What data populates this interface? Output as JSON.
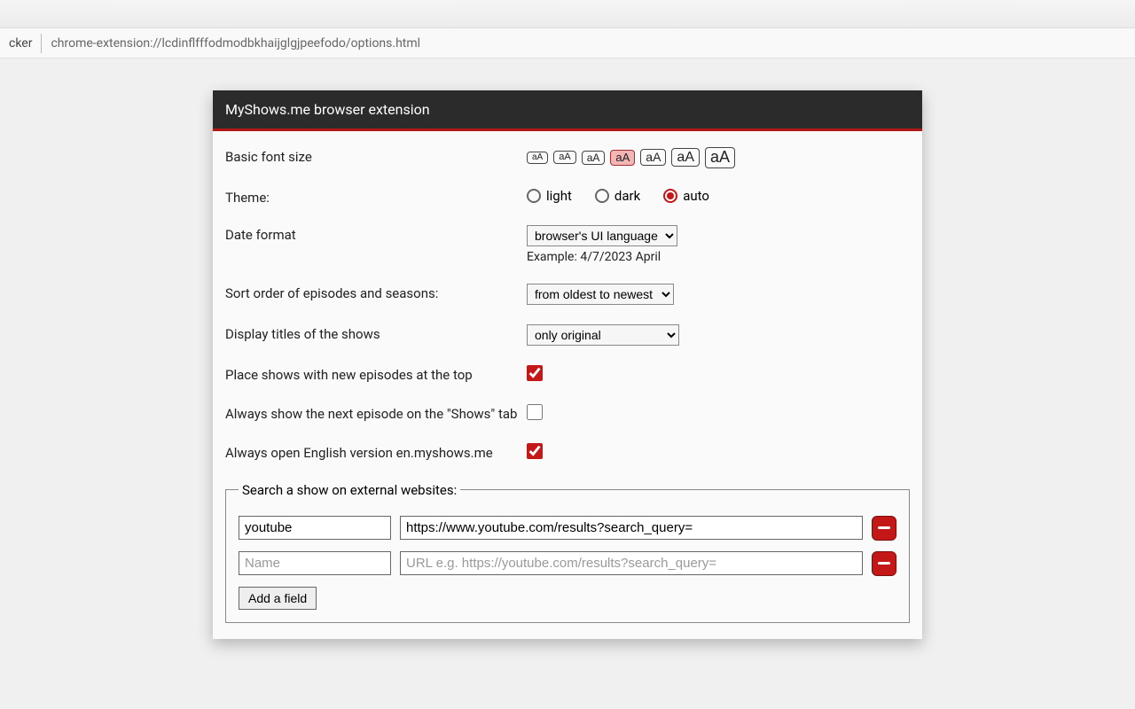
{
  "browser": {
    "tab_fragment": "cker",
    "url": "chrome-extension://lcdinflfffodmodbkhaijglgjpeefodo/options.html"
  },
  "panel": {
    "title": "MyShows.me browser extension"
  },
  "settings": {
    "font_size": {
      "label": "Basic font size",
      "buttons": [
        "aA",
        "aA",
        "aA",
        "aA",
        "aA",
        "aA",
        "aA"
      ],
      "selected_index": 3
    },
    "theme": {
      "label": "Theme:",
      "options": {
        "light": "light",
        "dark": "dark",
        "auto": "auto"
      },
      "selected": "auto"
    },
    "date_format": {
      "label": "Date format",
      "value": "browser's UI language",
      "example": "Example: 4/7/2023 April"
    },
    "sort_order": {
      "label": "Sort order of episodes and seasons:",
      "value": "from oldest to newest"
    },
    "display_titles": {
      "label": "Display titles of the shows",
      "value": "only original"
    },
    "place_top": {
      "label": "Place shows with new episodes at the top",
      "checked": true
    },
    "always_next": {
      "label": "Always show the next episode on the \"Shows\" tab",
      "checked": false
    },
    "always_en": {
      "label": "Always open English version en.myshows.me",
      "checked": true
    }
  },
  "external": {
    "legend": "Search a show on external websites:",
    "rows": [
      {
        "name": "youtube",
        "url": "https://www.youtube.com/results?search_query="
      },
      {
        "name": "",
        "url": ""
      }
    ],
    "name_placeholder": "Name",
    "url_placeholder": "URL e.g. https://youtube.com/results?search_query=",
    "add_label": "Add a field"
  }
}
